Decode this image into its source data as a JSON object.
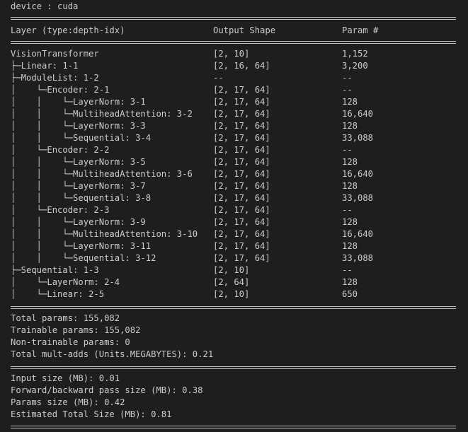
{
  "device_line": "device : cuda",
  "header": {
    "layer": "Layer (type:depth-idx)",
    "output": "Output Shape",
    "param": "Param #"
  },
  "rows": [
    {
      "tree": "VisionTransformer",
      "shape": "[2, 10]",
      "param": "1,152",
      "depth": 0
    },
    {
      "tree": "├─Linear: 1-1",
      "shape": "[2, 16, 64]",
      "param": "3,200",
      "depth": 0
    },
    {
      "tree": "├─ModuleList: 1-2",
      "shape": "--",
      "param": "--",
      "depth": 0
    },
    {
      "tree": "│    └─Encoder: 2-1",
      "shape": "[2, 17, 64]",
      "param": "--",
      "depth": 1
    },
    {
      "tree": "│    │    └─LayerNorm: 3-1",
      "shape": "[2, 17, 64]",
      "param": "128",
      "depth": 2
    },
    {
      "tree": "│    │    └─MultiheadAttention: 3-2",
      "shape": "[2, 17, 64]",
      "param": "16,640",
      "depth": 2
    },
    {
      "tree": "│    │    └─LayerNorm: 3-3",
      "shape": "[2, 17, 64]",
      "param": "128",
      "depth": 2
    },
    {
      "tree": "│    │    └─Sequential: 3-4",
      "shape": "[2, 17, 64]",
      "param": "33,088",
      "depth": 2
    },
    {
      "tree": "│    └─Encoder: 2-2",
      "shape": "[2, 17, 64]",
      "param": "--",
      "depth": 1
    },
    {
      "tree": "│    │    └─LayerNorm: 3-5",
      "shape": "[2, 17, 64]",
      "param": "128",
      "depth": 2
    },
    {
      "tree": "│    │    └─MultiheadAttention: 3-6",
      "shape": "[2, 17, 64]",
      "param": "16,640",
      "depth": 2
    },
    {
      "tree": "│    │    └─LayerNorm: 3-7",
      "shape": "[2, 17, 64]",
      "param": "128",
      "depth": 2
    },
    {
      "tree": "│    │    └─Sequential: 3-8",
      "shape": "[2, 17, 64]",
      "param": "33,088",
      "depth": 2
    },
    {
      "tree": "│    └─Encoder: 2-3",
      "shape": "[2, 17, 64]",
      "param": "--",
      "depth": 1
    },
    {
      "tree": "│    │    └─LayerNorm: 3-9",
      "shape": "[2, 17, 64]",
      "param": "128",
      "depth": 2
    },
    {
      "tree": "│    │    └─MultiheadAttention: 3-10",
      "shape": "[2, 17, 64]",
      "param": "16,640",
      "depth": 2
    },
    {
      "tree": "│    │    └─LayerNorm: 3-11",
      "shape": "[2, 17, 64]",
      "param": "128",
      "depth": 2
    },
    {
      "tree": "│    │    └─Sequential: 3-12",
      "shape": "[2, 17, 64]",
      "param": "33,088",
      "depth": 2
    },
    {
      "tree": "├─Sequential: 1-3",
      "shape": "[2, 10]",
      "param": "--",
      "depth": 0
    },
    {
      "tree": "│    └─LayerNorm: 2-4",
      "shape": "[2, 64]",
      "param": "128",
      "depth": 1
    },
    {
      "tree": "│    └─Linear: 2-5",
      "shape": "[2, 10]",
      "param": "650",
      "depth": 1
    }
  ],
  "params_summary": [
    "Total params: 155,082",
    "Trainable params: 155,082",
    "Non-trainable params: 0",
    "Total mult-adds (Units.MEGABYTES): 0.21"
  ],
  "size_summary": [
    "Input size (MB): 0.01",
    "Forward/backward pass size (MB): 0.38",
    "Params size (MB): 0.42",
    "Estimated Total Size (MB): 0.81"
  ]
}
